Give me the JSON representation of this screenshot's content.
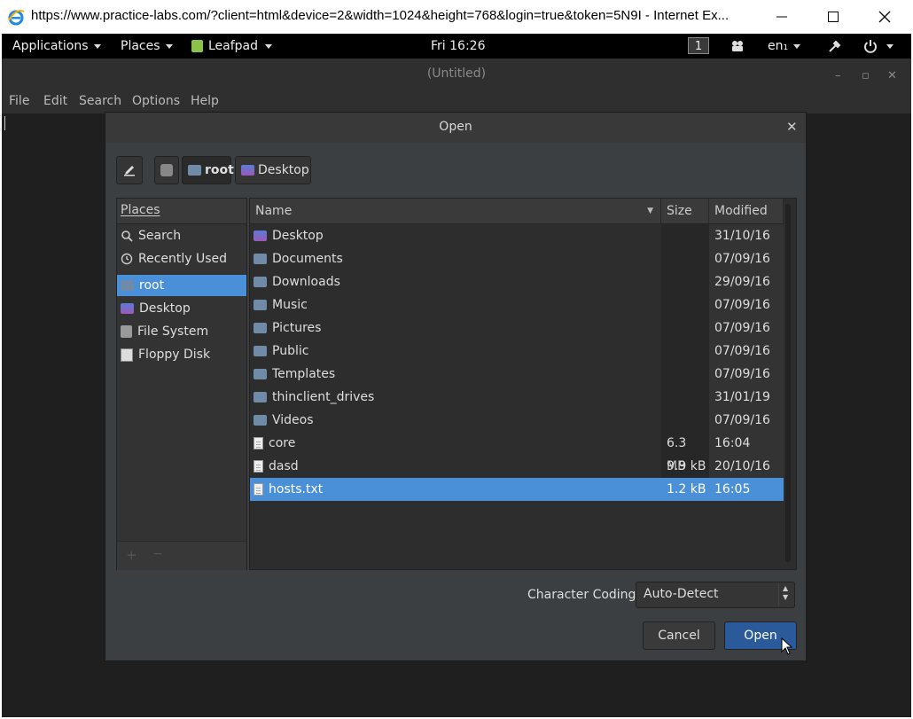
{
  "browser": {
    "title": "https://www.practice-labs.com/?client=html&device=2&width=1024&height=768&login=true&token=5N9I - Internet Ex...",
    "controls": [
      "minimize-icon",
      "maximize-icon",
      "close-icon"
    ]
  },
  "topbar": {
    "applications": "Applications",
    "places": "Places",
    "active_app": "Leafpad",
    "clock": "Fri 16:26",
    "workspace": "1",
    "keyboard": "en₁"
  },
  "leafpad": {
    "title": "(Untitled)",
    "menu": [
      "File",
      "Edit",
      "Search",
      "Options",
      "Help"
    ]
  },
  "dialog": {
    "title": "Open",
    "path": [
      {
        "label": "root",
        "icon": "home-folder-icon"
      },
      {
        "label": "Desktop",
        "icon": "desktop-folder-icon"
      }
    ],
    "places_header": "Places",
    "places": [
      {
        "label": "Search",
        "icon": "search-icon"
      },
      {
        "label": "Recently Used",
        "icon": "recent-icon"
      },
      {
        "label": "root",
        "icon": "home-icon",
        "selected": true
      },
      {
        "label": "Desktop",
        "icon": "desktop-icon"
      },
      {
        "label": "File System",
        "icon": "harddisk-icon"
      },
      {
        "label": "Floppy Disk",
        "icon": "floppy-icon"
      }
    ],
    "columns": {
      "name": "Name",
      "size": "Size",
      "modified": "Modified"
    },
    "files": [
      {
        "name": "Desktop",
        "size": "",
        "modified": "31/10/16",
        "type": "desktop-folder"
      },
      {
        "name": "Documents",
        "size": "",
        "modified": "07/09/16",
        "type": "folder"
      },
      {
        "name": "Downloads",
        "size": "",
        "modified": "29/09/16",
        "type": "folder"
      },
      {
        "name": "Music",
        "size": "",
        "modified": "07/09/16",
        "type": "folder"
      },
      {
        "name": "Pictures",
        "size": "",
        "modified": "07/09/16",
        "type": "folder"
      },
      {
        "name": "Public",
        "size": "",
        "modified": "07/09/16",
        "type": "folder"
      },
      {
        "name": "Templates",
        "size": "",
        "modified": "07/09/16",
        "type": "folder"
      },
      {
        "name": "thinclient_drives",
        "size": "",
        "modified": "31/01/19",
        "type": "folder"
      },
      {
        "name": "Videos",
        "size": "",
        "modified": "07/09/16",
        "type": "folder"
      },
      {
        "name": "core",
        "size": "6.3 MB",
        "modified": "16:04",
        "type": "file"
      },
      {
        "name": "dasd",
        "size": "9.9 kB",
        "modified": "20/10/16",
        "type": "file"
      },
      {
        "name": "hosts.txt",
        "size": "1.2 kB",
        "modified": "16:05",
        "type": "file",
        "selected": true
      }
    ],
    "coding_label": "Character Coding:",
    "coding_value": "Auto-Detect",
    "cancel": "Cancel",
    "open": "Open"
  }
}
